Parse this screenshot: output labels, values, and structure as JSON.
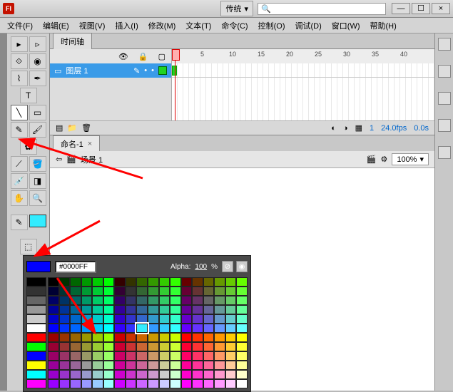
{
  "titlebar": {
    "layout_label": "传统",
    "search_placeholder": ""
  },
  "window_controls": {
    "min": "—",
    "max": "☐",
    "close": "×"
  },
  "menus": {
    "file": "文件(F)",
    "edit": "编辑(E)",
    "view": "视图(V)",
    "insert": "插入(I)",
    "modify": "修改(M)",
    "text": "文本(T)",
    "commands": "命令(C)",
    "control": "控制(O)",
    "debug": "调试(D)",
    "window": "窗口(W)",
    "help": "帮助(H)"
  },
  "timeline": {
    "tab": "时间轴",
    "ruler": [
      "5",
      "10",
      "15",
      "20",
      "25",
      "30",
      "35",
      "40"
    ],
    "layer_name": "图层 1",
    "status": {
      "frame": "1",
      "fps": "24.0fps",
      "time": "0.0s"
    }
  },
  "document": {
    "tab": "命名-1",
    "scene_label": "场景 1",
    "zoom": "100%"
  },
  "color_popup": {
    "hex": "#0000FF",
    "alpha_label": "Alpha:",
    "alpha_value": "100",
    "alpha_pct": "%"
  },
  "chart_data": null
}
